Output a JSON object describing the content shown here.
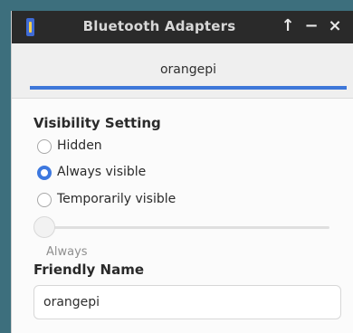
{
  "window": {
    "title": "Bluetooth Adapters",
    "buttons": {
      "maximize": "↑",
      "minimize": "−",
      "close": "×"
    }
  },
  "tabs": [
    {
      "label": "orangepi",
      "selected": true
    }
  ],
  "visibility": {
    "title": "Visibility Setting",
    "options": [
      {
        "label": "Hidden",
        "checked": false
      },
      {
        "label": "Always visible",
        "checked": true
      },
      {
        "label": "Temporarily visible",
        "checked": false
      }
    ],
    "slider_value_label": "Always",
    "slider_level": 0
  },
  "friendly_name": {
    "title": "Friendly Name",
    "value": "orangepi"
  },
  "colors": {
    "accent": "#3e77d9",
    "titlebar": "#2a2a2a",
    "background": "#fbfbfb"
  },
  "icons": {
    "app": "bluetooth-adapter-icon",
    "maximize": "arrow-up-icon",
    "minimize": "minus-icon",
    "close": "close-icon"
  }
}
